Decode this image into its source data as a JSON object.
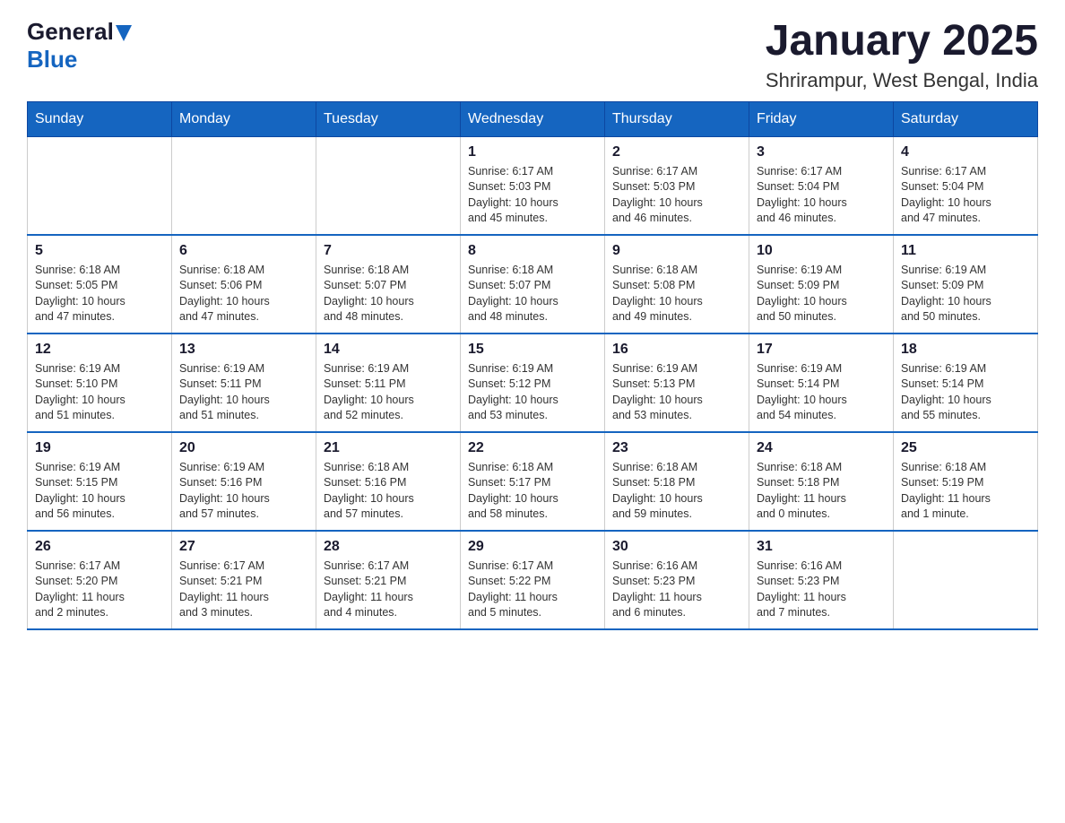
{
  "header": {
    "logo_general": "General",
    "logo_blue": "Blue",
    "title": "January 2025",
    "subtitle": "Shrirampur, West Bengal, India"
  },
  "days_of_week": [
    "Sunday",
    "Monday",
    "Tuesday",
    "Wednesday",
    "Thursday",
    "Friday",
    "Saturday"
  ],
  "weeks": [
    [
      {
        "day": "",
        "info": ""
      },
      {
        "day": "",
        "info": ""
      },
      {
        "day": "",
        "info": ""
      },
      {
        "day": "1",
        "info": "Sunrise: 6:17 AM\nSunset: 5:03 PM\nDaylight: 10 hours\nand 45 minutes."
      },
      {
        "day": "2",
        "info": "Sunrise: 6:17 AM\nSunset: 5:03 PM\nDaylight: 10 hours\nand 46 minutes."
      },
      {
        "day": "3",
        "info": "Sunrise: 6:17 AM\nSunset: 5:04 PM\nDaylight: 10 hours\nand 46 minutes."
      },
      {
        "day": "4",
        "info": "Sunrise: 6:17 AM\nSunset: 5:04 PM\nDaylight: 10 hours\nand 47 minutes."
      }
    ],
    [
      {
        "day": "5",
        "info": "Sunrise: 6:18 AM\nSunset: 5:05 PM\nDaylight: 10 hours\nand 47 minutes."
      },
      {
        "day": "6",
        "info": "Sunrise: 6:18 AM\nSunset: 5:06 PM\nDaylight: 10 hours\nand 47 minutes."
      },
      {
        "day": "7",
        "info": "Sunrise: 6:18 AM\nSunset: 5:07 PM\nDaylight: 10 hours\nand 48 minutes."
      },
      {
        "day": "8",
        "info": "Sunrise: 6:18 AM\nSunset: 5:07 PM\nDaylight: 10 hours\nand 48 minutes."
      },
      {
        "day": "9",
        "info": "Sunrise: 6:18 AM\nSunset: 5:08 PM\nDaylight: 10 hours\nand 49 minutes."
      },
      {
        "day": "10",
        "info": "Sunrise: 6:19 AM\nSunset: 5:09 PM\nDaylight: 10 hours\nand 50 minutes."
      },
      {
        "day": "11",
        "info": "Sunrise: 6:19 AM\nSunset: 5:09 PM\nDaylight: 10 hours\nand 50 minutes."
      }
    ],
    [
      {
        "day": "12",
        "info": "Sunrise: 6:19 AM\nSunset: 5:10 PM\nDaylight: 10 hours\nand 51 minutes."
      },
      {
        "day": "13",
        "info": "Sunrise: 6:19 AM\nSunset: 5:11 PM\nDaylight: 10 hours\nand 51 minutes."
      },
      {
        "day": "14",
        "info": "Sunrise: 6:19 AM\nSunset: 5:11 PM\nDaylight: 10 hours\nand 52 minutes."
      },
      {
        "day": "15",
        "info": "Sunrise: 6:19 AM\nSunset: 5:12 PM\nDaylight: 10 hours\nand 53 minutes."
      },
      {
        "day": "16",
        "info": "Sunrise: 6:19 AM\nSunset: 5:13 PM\nDaylight: 10 hours\nand 53 minutes."
      },
      {
        "day": "17",
        "info": "Sunrise: 6:19 AM\nSunset: 5:14 PM\nDaylight: 10 hours\nand 54 minutes."
      },
      {
        "day": "18",
        "info": "Sunrise: 6:19 AM\nSunset: 5:14 PM\nDaylight: 10 hours\nand 55 minutes."
      }
    ],
    [
      {
        "day": "19",
        "info": "Sunrise: 6:19 AM\nSunset: 5:15 PM\nDaylight: 10 hours\nand 56 minutes."
      },
      {
        "day": "20",
        "info": "Sunrise: 6:19 AM\nSunset: 5:16 PM\nDaylight: 10 hours\nand 57 minutes."
      },
      {
        "day": "21",
        "info": "Sunrise: 6:18 AM\nSunset: 5:16 PM\nDaylight: 10 hours\nand 57 minutes."
      },
      {
        "day": "22",
        "info": "Sunrise: 6:18 AM\nSunset: 5:17 PM\nDaylight: 10 hours\nand 58 minutes."
      },
      {
        "day": "23",
        "info": "Sunrise: 6:18 AM\nSunset: 5:18 PM\nDaylight: 10 hours\nand 59 minutes."
      },
      {
        "day": "24",
        "info": "Sunrise: 6:18 AM\nSunset: 5:18 PM\nDaylight: 11 hours\nand 0 minutes."
      },
      {
        "day": "25",
        "info": "Sunrise: 6:18 AM\nSunset: 5:19 PM\nDaylight: 11 hours\nand 1 minute."
      }
    ],
    [
      {
        "day": "26",
        "info": "Sunrise: 6:17 AM\nSunset: 5:20 PM\nDaylight: 11 hours\nand 2 minutes."
      },
      {
        "day": "27",
        "info": "Sunrise: 6:17 AM\nSunset: 5:21 PM\nDaylight: 11 hours\nand 3 minutes."
      },
      {
        "day": "28",
        "info": "Sunrise: 6:17 AM\nSunset: 5:21 PM\nDaylight: 11 hours\nand 4 minutes."
      },
      {
        "day": "29",
        "info": "Sunrise: 6:17 AM\nSunset: 5:22 PM\nDaylight: 11 hours\nand 5 minutes."
      },
      {
        "day": "30",
        "info": "Sunrise: 6:16 AM\nSunset: 5:23 PM\nDaylight: 11 hours\nand 6 minutes."
      },
      {
        "day": "31",
        "info": "Sunrise: 6:16 AM\nSunset: 5:23 PM\nDaylight: 11 hours\nand 7 minutes."
      },
      {
        "day": "",
        "info": ""
      }
    ]
  ]
}
